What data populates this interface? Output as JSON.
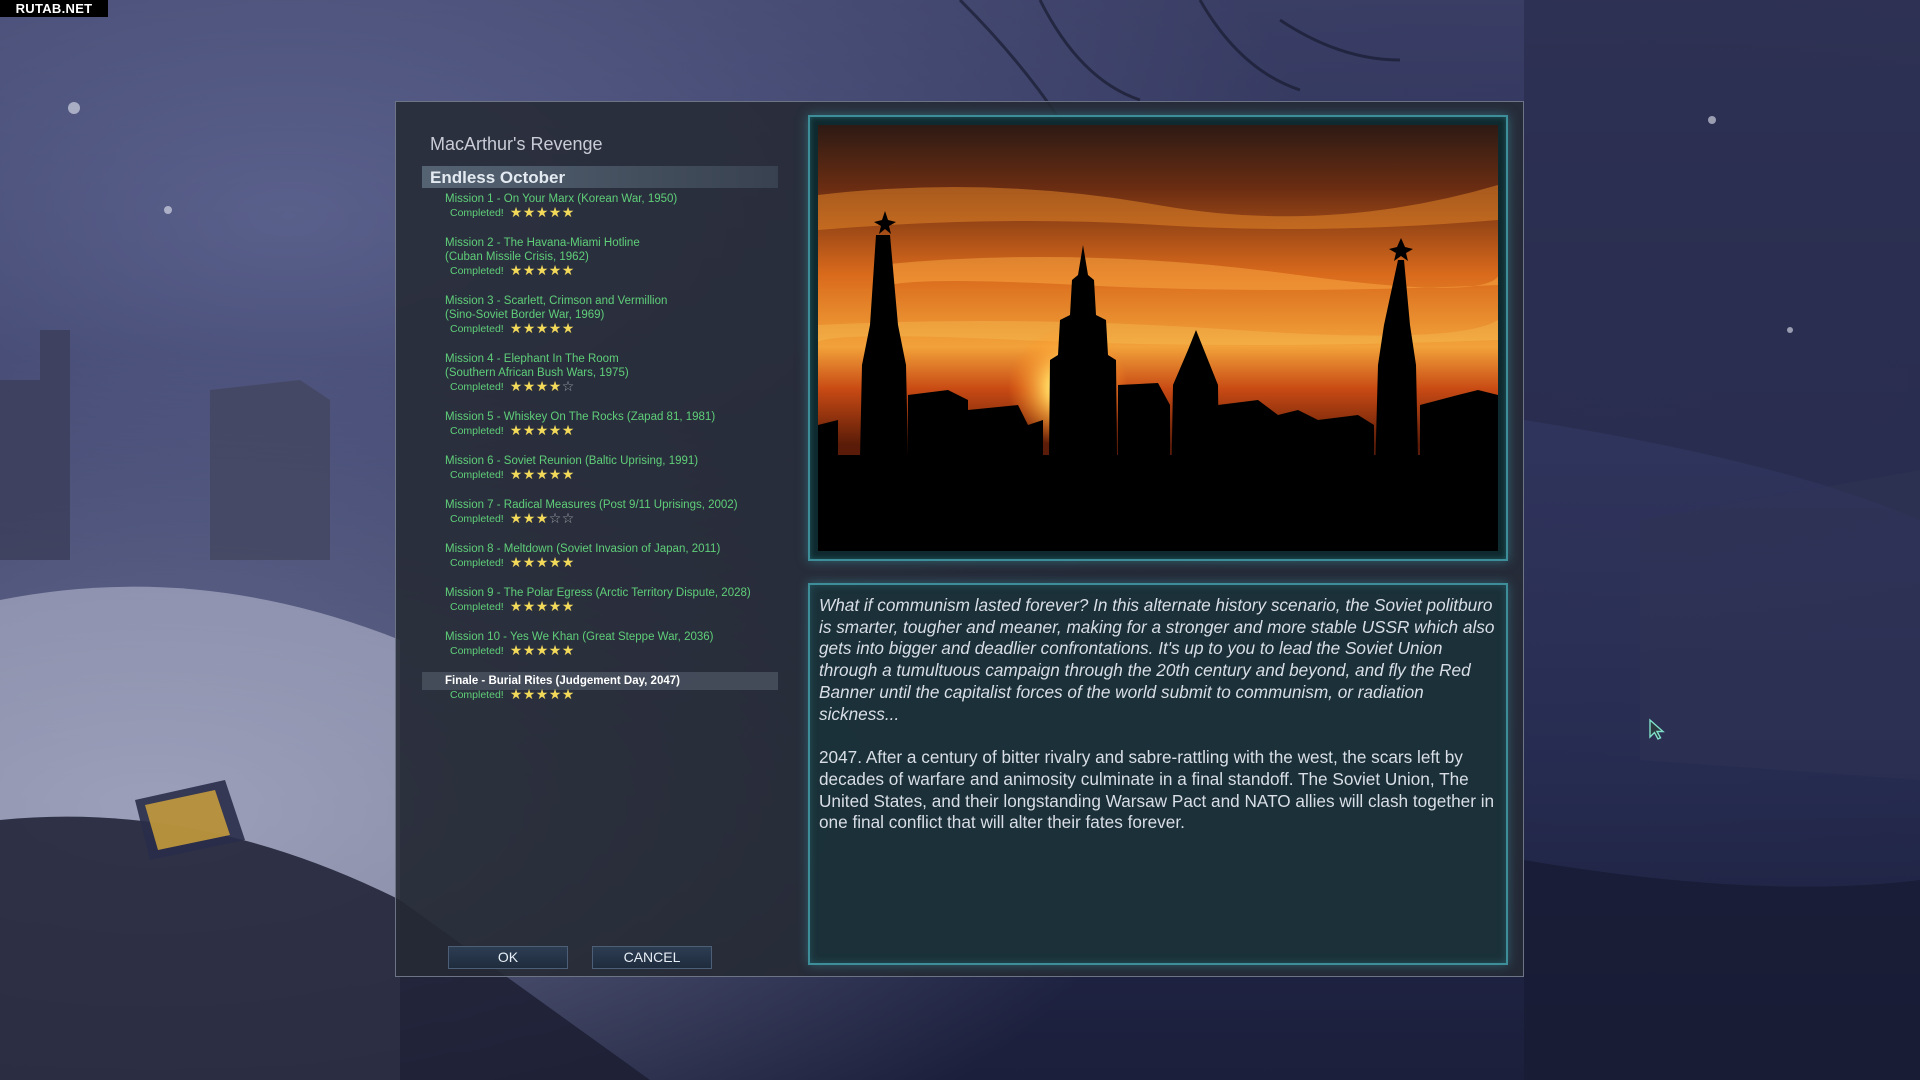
{
  "watermark": "RUTAB.NET",
  "campaign_title": "MacArthur's Revenge",
  "chapter_title": "Endless October",
  "completed_label": "Completed!",
  "missions": [
    {
      "title": "Mission 1 - On Your Marx (Korean War, 1950)",
      "stars": 5
    },
    {
      "title": "Mission 2 - The Havana-Miami Hotline\n(Cuban Missile Crisis, 1962)",
      "stars": 5
    },
    {
      "title": "Mission 3 - Scarlett, Crimson and Vermillion\n(Sino-Soviet Border War, 1969)",
      "stars": 5
    },
    {
      "title": "Mission 4 - Elephant In The Room\n(Southern African Bush Wars, 1975)",
      "stars": 4
    },
    {
      "title": "Mission 5 - Whiskey On The Rocks (Zapad 81, 1981)",
      "stars": 5
    },
    {
      "title": "Mission 6 - Soviet Reunion (Baltic Uprising, 1991)",
      "stars": 5
    },
    {
      "title": "Mission 7 - Radical Measures (Post 9/11 Uprisings, 2002)",
      "stars": 3
    },
    {
      "title": "Mission 8 - Meltdown (Soviet Invasion of Japan, 2011)",
      "stars": 5
    },
    {
      "title": "Mission 9 - The Polar Egress (Arctic Territory Dispute, 2028)",
      "stars": 5
    },
    {
      "title": "Mission 10 - Yes We Khan (Great Steppe War, 2036)",
      "stars": 5
    },
    {
      "title": "Finale - Burial Rites (Judgement Day, 2047)",
      "stars": 5,
      "selected": true
    }
  ],
  "max_stars": 5,
  "buttons": {
    "ok": "OK",
    "cancel": "CANCEL"
  },
  "description": {
    "intro": "What if communism lasted forever? In this alternate history scenario, the Soviet politburo is smarter, tougher and meaner, making for a stronger and more stable USSR which also gets into bigger and deadlier confrontations. It's up to you to lead the Soviet Union through a tumultuous campaign through the 20th century and beyond, and fly the Red Banner until the capitalist forces of the world submit to communism, or radiation sickness...",
    "body": "2047. After a century of bitter rivalry and sabre-rattling with the west, the scars left by decades of warfare and animosity culminate in a final standoff. The Soviet Union, The United States, and their longstanding Warsaw Pact and NATO allies will clash together in one final conflict that will alter their fates forever."
  },
  "colors": {
    "mission_text": "#5fcf79",
    "star_full": "#f2d95a",
    "star_empty": "#9aa0a8",
    "frame_accent": "#3d8e98"
  },
  "icons": {
    "cursor": "cursor-arrow-icon",
    "preview": "kremlin-sunset-image"
  }
}
